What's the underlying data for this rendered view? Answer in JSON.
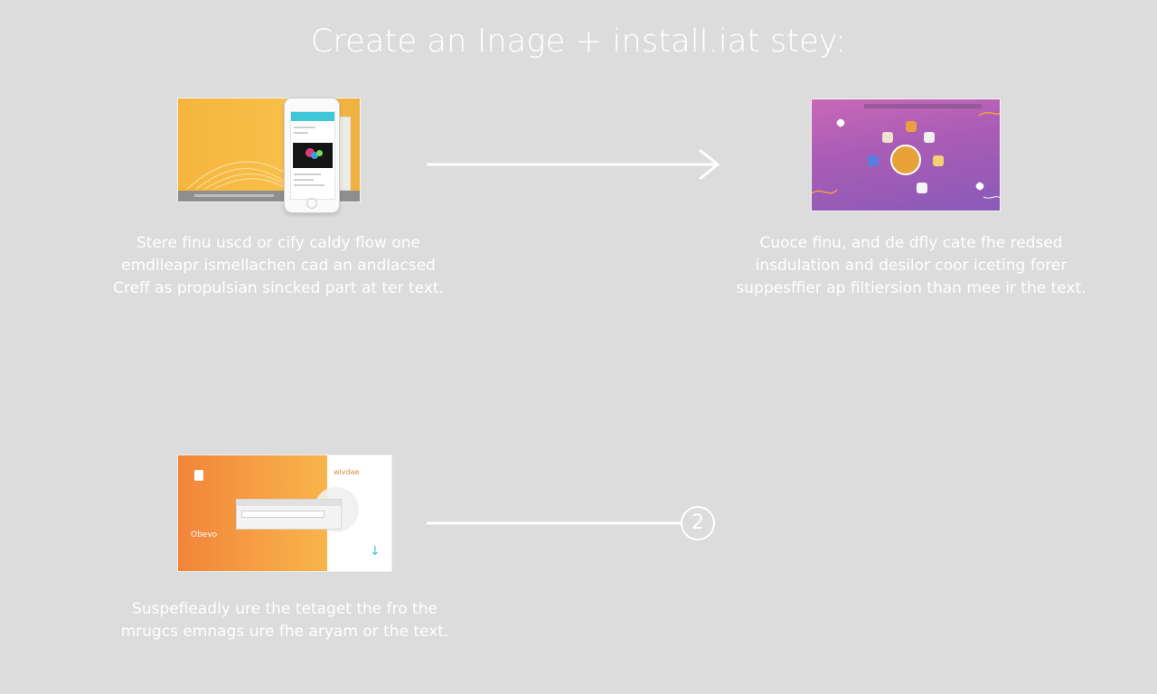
{
  "title": "Create an Inage + install.iat stey:",
  "steps": [
    {
      "caption_lines": [
        "Stere finu uscd or cify caldy flow one",
        "emdlleapr ismellachen cad an andlacsed",
        "Creff as propulsian sincked part at ter text."
      ]
    },
    {
      "caption_lines": [
        "Cuoce finu, and de dfly cate fhe redsed",
        "insdulation and desilor coor iceting forer",
        "suppesffier ap filtiersion than mee ir the text."
      ]
    },
    {
      "caption_lines": [
        "Suspefieadly ure the tetaget the fro the",
        "mrugcs emnags ure fhe aryam or the text."
      ],
      "image_small_text": "Obevo",
      "image_brand_text": "wlvdae"
    }
  ],
  "connector_number": "2",
  "colors": {
    "background": "#dcdcdc",
    "accent_cyan": "#3ec7d6",
    "step1_yellow": "#f5b53d",
    "step2_purple": "#a85cb5",
    "step3_orange": "#f2843a"
  },
  "icons": {
    "arrow": "arrow-right-icon",
    "step3_download": "download-arrow-icon"
  }
}
